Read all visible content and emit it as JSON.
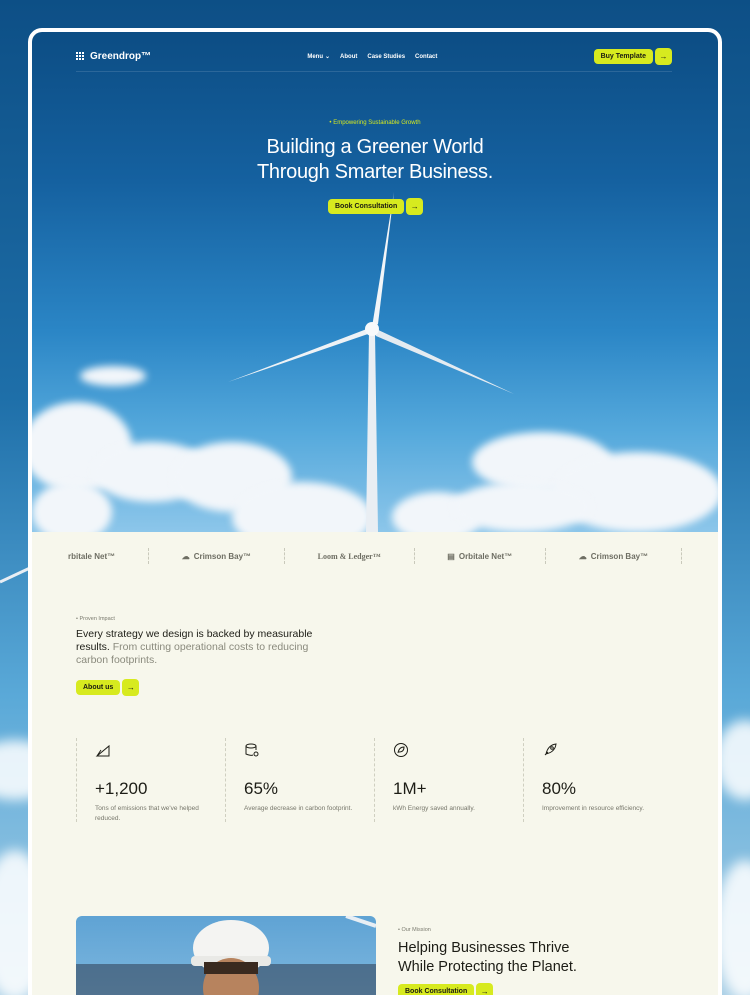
{
  "brand": {
    "name": "Greendrop™"
  },
  "nav": {
    "menu": "Menu",
    "about": "About",
    "case_studies": "Case Studies",
    "contact": "Contact",
    "cta": "Buy Template"
  },
  "hero": {
    "eyebrow": "Empowering Sustainable Growth",
    "title_line1": "Building a Greener World",
    "title_line2": "Through Smarter Business.",
    "cta": "Book Consultation"
  },
  "partners": [
    "rbitale Net™",
    "Crimson Bay™",
    "Loom & Ledger™",
    "Orbitale Net™",
    "Crimson Bay™"
  ],
  "impact": {
    "eyebrow": "Proven Impact",
    "text_strong": "Every strategy we design is backed by measurable results.",
    "text_muted": "From cutting operational costs to reducing carbon footprints.",
    "cta": "About us"
  },
  "stats": [
    {
      "icon": "leaf-icon",
      "value": "+1,200",
      "desc": "Tons of emissions that we've helped reduced."
    },
    {
      "icon": "database-search-icon",
      "value": "65%",
      "desc": "Average decrease in carbon footprint."
    },
    {
      "icon": "eco-badge-icon",
      "value": "1M+",
      "desc": "kWh Energy saved annually."
    },
    {
      "icon": "rocket-icon",
      "value": "80%",
      "desc": "Improvement in resource efficiency."
    }
  ],
  "mission": {
    "eyebrow": "Our Mission",
    "title_line1": "Helping Businesses Thrive",
    "title_line2": "While Protecting the Planet.",
    "cta": "Book Consultation"
  },
  "colors": {
    "accent": "#d7ea1f",
    "sky": "#1561a0",
    "cream": "#f7f7ec"
  }
}
